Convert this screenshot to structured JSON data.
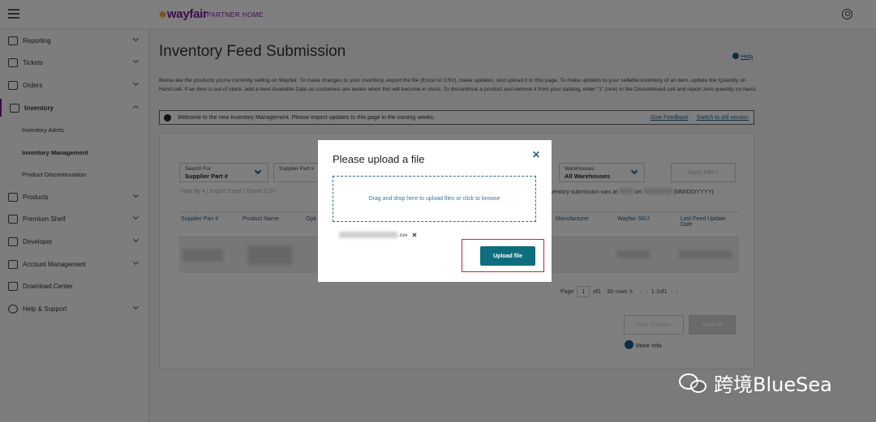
{
  "header": {
    "logo": "wayfair",
    "logo_sub": "PARTNER HOME"
  },
  "sidebar": {
    "items": [
      {
        "label": "Reporting"
      },
      {
        "label": "Tickets"
      },
      {
        "label": "Orders"
      },
      {
        "label": "Inventory"
      },
      {
        "label": "Products"
      },
      {
        "label": "Premium Shelf"
      },
      {
        "label": "Developer"
      },
      {
        "label": "Account Management"
      },
      {
        "label": "Download Center"
      },
      {
        "label": "Help & Support"
      }
    ],
    "inventory_sub": [
      {
        "label": "Inventory Alerts"
      },
      {
        "label": "Inventory Management"
      },
      {
        "label": "Product Discontinuation"
      }
    ]
  },
  "main": {
    "title": "Inventory Feed Submission",
    "help": "Help",
    "description": "Below are the products you're currently selling on Wayfair. To make changes to your inventory, export the file (Excel or CSV), make updates, and upload it to this page. To make updates to your sellable inventory of an item, update the Quantity on Hand cell. If an item is out of stock, add a Next Available Date so customers are aware when this will become in stock. To discontinue a product and remove it from your catalog, enter \"1\" (one) in the Discontinued cell and report zero quantity on hand.",
    "banner": {
      "message": "Welcome to the new Inventory Management. Please expect updates to this page in the coming weeks.",
      "feedback": "Give Feedback",
      "old_version": "Switch to old version"
    },
    "filters": {
      "search_for_label": "Search For",
      "search_for_value": "Supplier Part #",
      "supplier_part_label": "Supplier Part #",
      "warehouses_label": "Warehouses",
      "warehouses_value": "All Warehouses",
      "apply": "Apply Filters"
    },
    "view_row": "View By  ▾    |    Export Excel    |    Export CSV",
    "last_submission_prefix": "nventory submission was at",
    "last_submission_on": "on",
    "last_submission_format": "(MM/DD/YYYY)",
    "columns": [
      "Supplier Part #",
      "Product Name",
      "Opti",
      "Manufacturer",
      "Wayfair SKU",
      "Last Feed Update Date"
    ],
    "pager": {
      "page_label": "Page",
      "page": "1",
      "of": "of1",
      "rows": "50 rows ≑",
      "range": "1-1of1"
    },
    "save_changes": "Save Changes",
    "save_all": "Save All",
    "more_info": "More Info"
  },
  "modal": {
    "title": "Please upload a file",
    "dropzone_text": "Drag and drop here to upload files or click to browse",
    "file_ext": ".csv",
    "upload_button": "Upload file"
  },
  "watermark": "跨境BlueSea"
}
